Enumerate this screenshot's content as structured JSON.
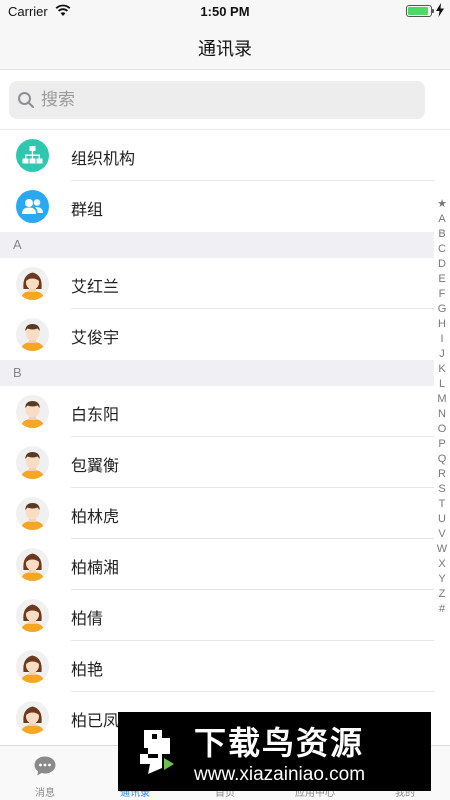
{
  "status_bar": {
    "carrier": "Carrier",
    "time": "1:50 PM",
    "battery_level": 0.92
  },
  "nav": {
    "title": "通讯录"
  },
  "search": {
    "placeholder": "搜索"
  },
  "top_items": [
    {
      "label": "组织机构",
      "icon": "org-chart-icon",
      "color": "#2fc7b0"
    },
    {
      "label": "群组",
      "icon": "group-icon",
      "color": "#2aa9f2"
    }
  ],
  "sections": [
    {
      "letter": "A",
      "contacts": [
        {
          "name": "艾红兰",
          "avatar": "female-avatar-icon"
        },
        {
          "name": "艾俊宇",
          "avatar": "male-avatar-icon"
        }
      ]
    },
    {
      "letter": "B",
      "contacts": [
        {
          "name": "白东阳",
          "avatar": "male-avatar-icon"
        },
        {
          "name": "包翼衡",
          "avatar": "male-avatar-icon"
        },
        {
          "name": "柏林虎",
          "avatar": "male-avatar-icon"
        },
        {
          "name": "柏楠湘",
          "avatar": "female-avatar-icon"
        },
        {
          "name": "柏倩",
          "avatar": "female-avatar-icon"
        },
        {
          "name": "柏艳",
          "avatar": "female-avatar-icon"
        },
        {
          "name": "柏已凤",
          "avatar": "female-avatar-icon"
        }
      ]
    }
  ],
  "index_letters": [
    "★",
    "A",
    "B",
    "C",
    "D",
    "E",
    "F",
    "G",
    "H",
    "I",
    "J",
    "K",
    "L",
    "M",
    "N",
    "O",
    "P",
    "Q",
    "R",
    "S",
    "T",
    "U",
    "V",
    "W",
    "X",
    "Y",
    "Z",
    "#"
  ],
  "tabs": [
    {
      "label": "消息",
      "icon": "chat-bubble-icon",
      "active": false
    },
    {
      "label": "通讯录",
      "icon": "contacts-icon",
      "active": true
    },
    {
      "label": "首页",
      "icon": "home-icon",
      "active": false
    },
    {
      "label": "应用中心",
      "icon": "apps-icon",
      "active": false
    },
    {
      "label": "我的",
      "icon": "profile-icon",
      "active": false
    }
  ],
  "watermark": {
    "title": "下载鸟资源",
    "url": "www.xiazainiao.com"
  },
  "colors": {
    "accent": "#2a8ae6",
    "section_bg": "#efeff4",
    "avatar_shirt": "#f5a623"
  }
}
